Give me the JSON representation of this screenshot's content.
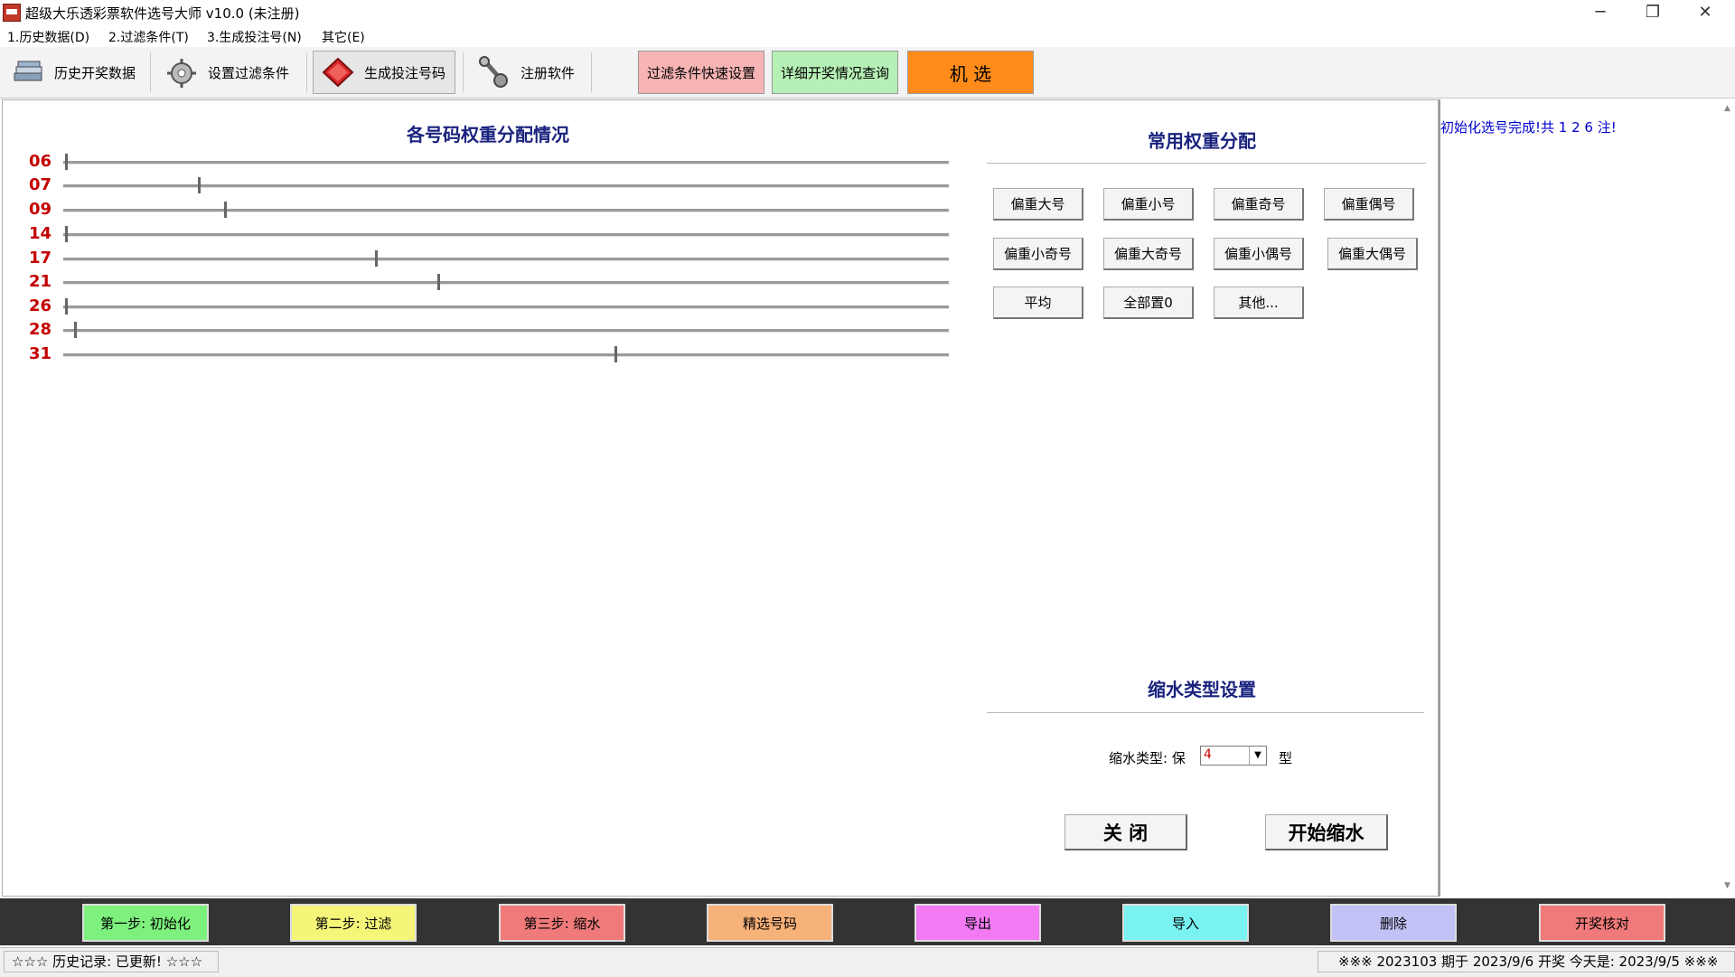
{
  "window": {
    "title": "超级大乐透彩票软件选号大师 v10.0 (未注册)",
    "minimize": "─",
    "restore": "❐",
    "close": "✕"
  },
  "menu": [
    "1.历史数据(D)",
    "2.过滤条件(T)",
    "3.生成投注号(N)",
    "其它(E)"
  ],
  "toolbar": {
    "history": "历史开奖数据",
    "filter": "设置过滤条件",
    "generate": "生成投注号码",
    "register": "注册软件",
    "quick_filter": "过滤条件快速设置",
    "detail_query": "详细开奖情况查询",
    "random_pick": "机 选",
    "colors": {
      "quick_filter": "#f6b4b4",
      "detail_query": "#b6f0b6",
      "random_pick": "#ff8c1a"
    }
  },
  "weights": {
    "title": "各号码权重分配情况",
    "rows": [
      {
        "label": "06",
        "level": 0.0
      },
      {
        "label": "07",
        "level": 0.15
      },
      {
        "label": "09",
        "level": 0.18
      },
      {
        "label": "14",
        "level": 0.0
      },
      {
        "label": "17",
        "level": 0.35
      },
      {
        "label": "21",
        "level": 0.42
      },
      {
        "label": "26",
        "level": 0.0
      },
      {
        "label": "28",
        "level": 0.01
      },
      {
        "label": "31",
        "level": 0.62
      }
    ]
  },
  "presets": {
    "title": "常用权重分配",
    "buttons": [
      "偏重大号",
      "偏重小号",
      "偏重奇号",
      "偏重偶号",
      "偏重小奇号",
      "偏重大奇号",
      "偏重小偶号",
      "偏重大偶号",
      "平均",
      "全部置0",
      "其他..."
    ]
  },
  "shrink": {
    "title": "缩水类型设置",
    "label": "缩水类型: 保",
    "value": "4",
    "suffix": "型",
    "close_button": "关 闭",
    "start_button": "开始缩水"
  },
  "info_panel": {
    "message": "初始化选号完成!共 1 2 6 注!"
  },
  "steps": [
    {
      "label": "第一步: 初始化",
      "color": "#7df07d"
    },
    {
      "label": "第二步: 过滤",
      "color": "#f5f57a"
    },
    {
      "label": "第三步: 缩水",
      "color": "#f07a7a"
    },
    {
      "label": "精选号码",
      "color": "#f7b27a"
    },
    {
      "label": "导出",
      "color": "#f27af2"
    },
    {
      "label": "导入",
      "color": "#7af2f2"
    },
    {
      "label": "删除",
      "color": "#c2c2f7"
    },
    {
      "label": "开奖核对",
      "color": "#f07a7a"
    }
  ],
  "status": {
    "left": "☆☆☆ 历史记录: 已更新! ☆☆☆",
    "right": "※※※ 2023103 期于 2023/9/6 开奖    今天是: 2023/9/5 ※※※"
  }
}
